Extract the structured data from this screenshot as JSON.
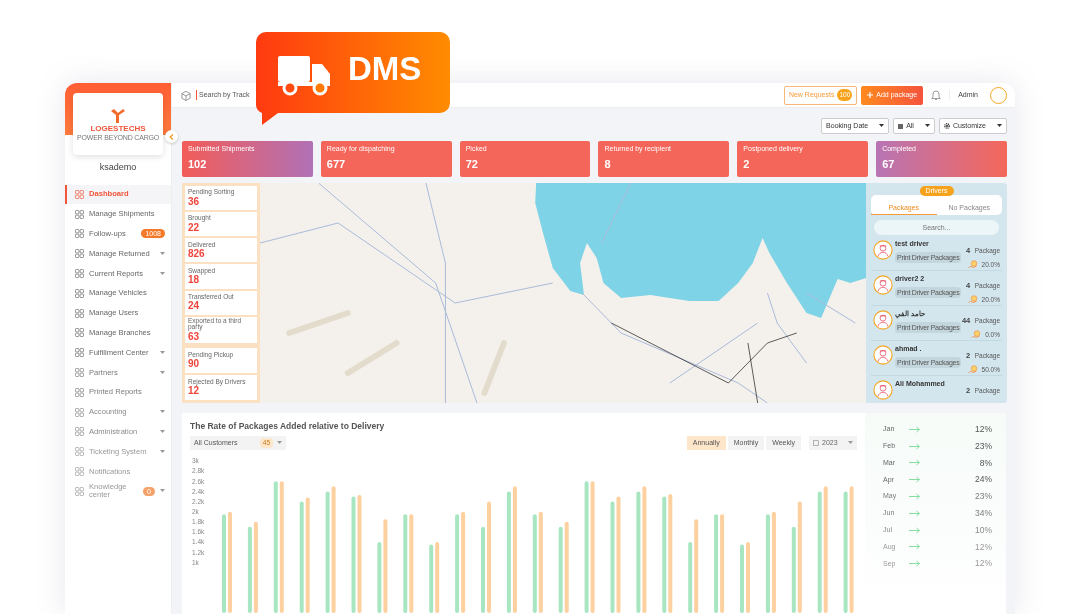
{
  "badge": {
    "text": "DMS"
  },
  "sidebar": {
    "logo": {
      "name": "LOGESTECHS",
      "tagline": "POWER BEYOND CARGO"
    },
    "username": "ksademo",
    "items": [
      {
        "label": "Dashboard",
        "selected": true,
        "submenu": false
      },
      {
        "label": "Manage Shipments",
        "selected": false,
        "submenu": false
      },
      {
        "label": "Follow-ups",
        "selected": false,
        "submenu": false,
        "badge": "1008"
      },
      {
        "label": "Manage Returned",
        "selected": false,
        "submenu": true
      },
      {
        "label": "Current Reports",
        "selected": false,
        "submenu": true
      },
      {
        "label": "Manage Vehicles",
        "selected": false,
        "submenu": false
      },
      {
        "label": "Manage Users",
        "selected": false,
        "submenu": false
      },
      {
        "label": "Manage Branches",
        "selected": false,
        "submenu": false
      },
      {
        "label": "Fulfillment Center",
        "selected": false,
        "submenu": true
      },
      {
        "label": "Partners",
        "selected": false,
        "submenu": true
      },
      {
        "label": "Printed Reports",
        "selected": false,
        "submenu": false
      },
      {
        "label": "Accounting",
        "selected": false,
        "submenu": true
      },
      {
        "label": "Administration",
        "selected": false,
        "submenu": true
      },
      {
        "label": "Ticketing System",
        "selected": false,
        "submenu": true
      },
      {
        "label": "Notifications",
        "selected": false,
        "submenu": false
      },
      {
        "label": "Knowledge center",
        "selected": false,
        "submenu": true,
        "badge": "0"
      }
    ]
  },
  "topbar": {
    "search_placeholder": "Search by Track",
    "new_requests": {
      "label": "New Requests",
      "count": "100"
    },
    "add_button": "Add package",
    "user": "Admin"
  },
  "filters": [
    {
      "label": "Booking Date",
      "kind": "plain"
    },
    {
      "label": "All",
      "kind": "date"
    },
    {
      "label": "Customize",
      "kind": "settings"
    }
  ],
  "stats": [
    {
      "label": "Submitted Shipments",
      "value": "102",
      "kind": "blend"
    },
    {
      "label": "Ready for dispatching",
      "value": "677",
      "kind": "plain"
    },
    {
      "label": "Picked",
      "value": "72",
      "kind": "plain"
    },
    {
      "label": "Returned by recipient",
      "value": "8",
      "kind": "plain"
    },
    {
      "label": "Postponed delivery",
      "value": "2",
      "kind": "plain"
    },
    {
      "label": "Completed",
      "value": "67",
      "kind": "blendrev"
    }
  ],
  "mini_stats": [
    [
      {
        "label": "Pending Sorting",
        "value": "36"
      },
      {
        "label": "Brought",
        "value": "22"
      },
      {
        "label": "Delivered",
        "value": "826"
      },
      {
        "label": "Swapped",
        "value": "18"
      },
      {
        "label": "Transferred Out",
        "value": "24"
      },
      {
        "label": "Exported to a third party",
        "value": "63"
      }
    ],
    [
      {
        "label": "Pending Pickup",
        "value": "90"
      },
      {
        "label": "Rejected By Drivers",
        "value": "12"
      }
    ]
  ],
  "drivers": {
    "header": "Drivers",
    "tabs": [
      {
        "label": "Packages",
        "selected": true
      },
      {
        "label": "No Packages",
        "selected": false
      }
    ],
    "search_placeholder": "Search...",
    "rows": [
      {
        "name": "test driver",
        "action": "Print Driver Packages",
        "count": "4",
        "unit": "Package",
        "rate": "20.0%"
      },
      {
        "name": "driver2 2",
        "action": "Print Driver Packages",
        "count": "4",
        "unit": "Package",
        "rate": "20.0%"
      },
      {
        "name": "حامد الفي",
        "action": "Print Driver Packages",
        "count": "44",
        "unit": "Package",
        "rate": "0.0%"
      },
      {
        "name": "ahmad .",
        "action": "Print Driver Packages",
        "count": "2",
        "unit": "Package",
        "rate": "50.0%"
      },
      {
        "name": "Ali Mohammed",
        "count": "2",
        "unit": "Package"
      }
    ]
  },
  "chart_panel": {
    "title": "The Rate of Packages Added relative to Delivery",
    "customer_filter": {
      "label": "All Customers",
      "count": "45"
    },
    "periods": [
      {
        "label": "Annually",
        "selected": true
      },
      {
        "label": "Monthly",
        "selected": false
      },
      {
        "label": "Weekly",
        "selected": false
      }
    ],
    "year": "2023",
    "chart_data": {
      "type": "bar",
      "ylim": [
        0,
        3000
      ],
      "categories": [
        null,
        null,
        null,
        null,
        null,
        null,
        null,
        null,
        null,
        null,
        null,
        null,
        null,
        null,
        null,
        null,
        null,
        null,
        null,
        null,
        null,
        null,
        null,
        null,
        null
      ],
      "yticks": [
        {
          "value": 3000,
          "label": "3k"
        },
        {
          "value": 2800,
          "label": "2.8k"
        },
        {
          "value": 2600,
          "label": "2.6k"
        },
        {
          "value": 2400,
          "label": "2.4k"
        },
        {
          "value": 2200,
          "label": "2.2k"
        },
        {
          "value": 2000,
          "label": "2k"
        },
        {
          "value": 1800,
          "label": "1.8k"
        },
        {
          "value": 1600,
          "label": "1.6k"
        },
        {
          "value": 1400,
          "label": "1.4k"
        },
        {
          "value": 1200,
          "label": "1.2k"
        },
        {
          "value": 1000,
          "label": "1k"
        }
      ],
      "series": [
        {
          "color": "#a8e6c1",
          "values": [
            1950,
            1700,
            2600,
            2200,
            2400,
            2300,
            1400,
            1950,
            1350,
            1950,
            1700,
            2400,
            1950,
            1700,
            2600,
            2200,
            2400,
            2300,
            1400,
            1950,
            1350,
            1950,
            1700,
            2400,
            2400
          ]
        },
        {
          "color": "#fdd09f",
          "values": [
            2000,
            1800,
            2600,
            2280,
            2500,
            2330,
            1850,
            1950,
            1400,
            2000,
            2200,
            2500,
            2000,
            1800,
            2600,
            2300,
            2500,
            2350,
            1850,
            1950,
            1400,
            2000,
            2200,
            2500,
            2500
          ]
        }
      ]
    }
  },
  "months": [
    {
      "month": "Jan",
      "value": "12%"
    },
    {
      "month": "Feb",
      "value": "23%"
    },
    {
      "month": "Mar",
      "value": "8%"
    },
    {
      "month": "Apr",
      "value": "24%"
    },
    {
      "month": "May",
      "value": "23%"
    },
    {
      "month": "Jun",
      "value": "34%"
    },
    {
      "month": "Jul",
      "value": "10%"
    },
    {
      "month": "Aug",
      "value": "12%"
    },
    {
      "month": "Sep",
      "value": "12%"
    }
  ]
}
